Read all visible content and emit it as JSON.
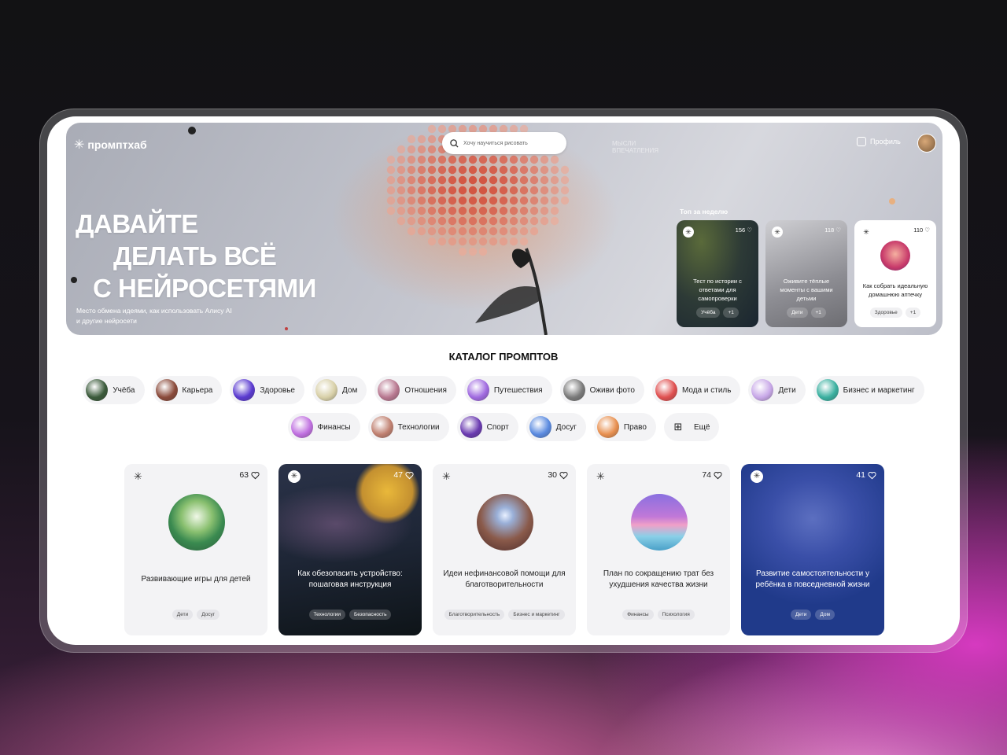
{
  "app": {
    "name": "промптхаб"
  },
  "search": {
    "placeholder": "Хочу научиться рисовать"
  },
  "header": {
    "ghost_text_1": "МЫСЛИ",
    "ghost_text_2": "ВПЕЧАТЛЕНИЯ",
    "profile_label": "Профиль"
  },
  "hero": {
    "headline_1": "ДАВАЙТЕ",
    "headline_2": "ДЕЛАТЬ ВСЁ",
    "headline_3": "С НЕЙРОСЕТЯМИ",
    "subtitle": "Место обмена идеями, как использовать Алису AI и другие нейросети"
  },
  "top_week": {
    "title": "Топ за неделю",
    "cards": [
      {
        "count": "156",
        "title": "Тест по истории с ответами для самопроверки",
        "tags": [
          "Учёба",
          "+1"
        ]
      },
      {
        "count": "118",
        "title": "Оживите тёплые моменты с вашими детьми",
        "tags": [
          "Дети",
          "+1"
        ]
      },
      {
        "count": "110",
        "title": "Как собрать идеальную домашнюю аптечку",
        "tags": [
          "Здоровье",
          "+1"
        ]
      }
    ]
  },
  "catalog": {
    "title": "КАТАЛОГ ПРОМПТОВ",
    "row1": [
      {
        "label": "Учёба",
        "color": "#3a5a3a"
      },
      {
        "label": "Карьера",
        "color": "#8a4a3a"
      },
      {
        "label": "Здоровье",
        "color": "#5a3ad0"
      },
      {
        "label": "Дом",
        "color": "#d8d0a8"
      },
      {
        "label": "Отношения",
        "color": "#b87890"
      },
      {
        "label": "Путешествия",
        "color": "#a06ae0"
      },
      {
        "label": "Оживи фото",
        "color": "#7a7a7a"
      },
      {
        "label": "Мода и стиль",
        "color": "#e05050"
      },
      {
        "label": "Дети",
        "color": "#c8a8e8"
      },
      {
        "label": "Бизнес и маркетинг",
        "color": "#3ab0a0"
      }
    ],
    "row2": [
      {
        "label": "Финансы",
        "color": "#c070e0"
      },
      {
        "label": "Технологии",
        "color": "#c08070"
      },
      {
        "label": "Спорт",
        "color": "#6a3ab0"
      },
      {
        "label": "Досуг",
        "color": "#5a8ae0"
      },
      {
        "label": "Право",
        "color": "#e89050"
      },
      {
        "label": "Ещё",
        "color": ""
      }
    ]
  },
  "cards": [
    {
      "count": "63",
      "title": "Развивающие игры для детей",
      "tags": [
        "Дети",
        "Досуг"
      ]
    },
    {
      "count": "47",
      "title": "Как обезопасить устройство: пошаговая инструкция",
      "tags": [
        "Технологии",
        "Безопасность"
      ]
    },
    {
      "count": "30",
      "title": "Идеи нефинансовой помощи для благотворительности",
      "tags": [
        "Благотворительность",
        "Бизнес и маркетинг"
      ]
    },
    {
      "count": "74",
      "title": "План по сокращению трат без ухудшения качества жизни",
      "tags": [
        "Финансы",
        "Психология"
      ]
    },
    {
      "count": "41",
      "title": "Развитие самостоятельности у ребёнка в повседневной жизни",
      "tags": [
        "Дети",
        "Дом"
      ]
    }
  ]
}
